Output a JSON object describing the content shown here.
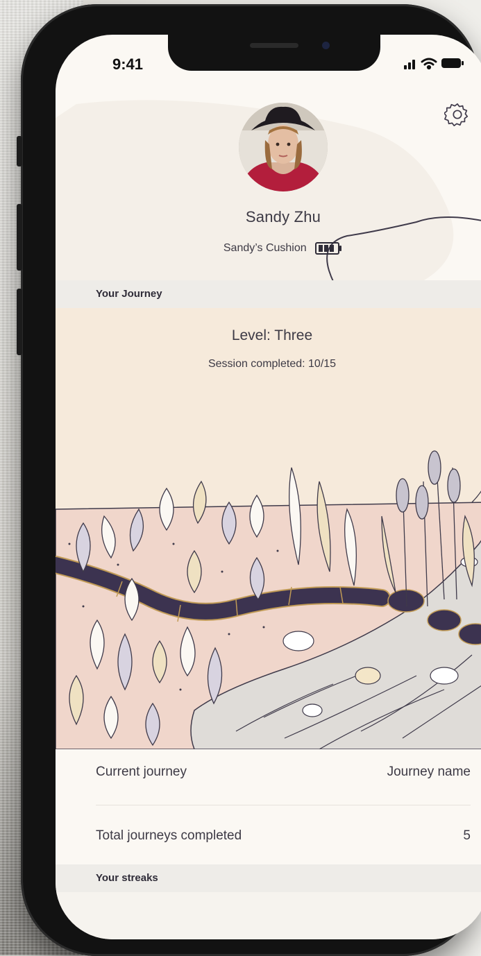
{
  "status_bar": {
    "time": "9:41"
  },
  "profile": {
    "name": "Sandy Zhu",
    "device_name": "Sandy’s Cushion"
  },
  "sections": {
    "journey_header": "Your Journey",
    "streaks_header": "Your streaks"
  },
  "journey": {
    "level": "Level: Three",
    "session_progress": "Session completed: 10/15"
  },
  "details": {
    "current_journey_label": "Current journey",
    "current_journey_value": "Journey name",
    "total_completed_label": "Total journeys completed",
    "total_completed_value": "5"
  },
  "icons": {
    "settings": "gear-icon",
    "battery": "battery-icon",
    "signal": "signal-icon",
    "wifi": "wifi-icon"
  },
  "colors": {
    "background": "#fbf8f3",
    "journey_bg": "#f6eadb",
    "path": "#3c3350",
    "text": "#3d3a45"
  }
}
